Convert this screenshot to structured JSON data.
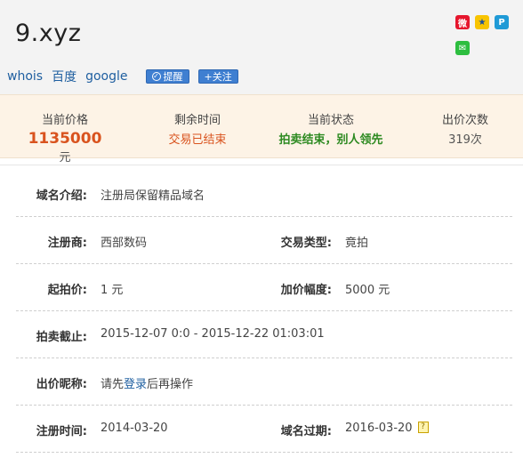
{
  "header": {
    "domain": "9.xyz",
    "links": {
      "whois": "whois",
      "baidu": "百度",
      "google": "google"
    },
    "remind_label": "提醒",
    "follow_label": "+关注"
  },
  "stats": {
    "price_label": "当前价格",
    "price_value": "1135000",
    "price_unit": "元",
    "time_label": "剩余时间",
    "time_value": "交易已结束",
    "status_label": "当前状态",
    "status_value": "拍卖结束，别人领先",
    "count_label": "出价次数",
    "count_value": "319次"
  },
  "details": {
    "intro_label": "域名介绍:",
    "intro_value": "注册局保留精品域名",
    "registrar_label": "注册商:",
    "registrar_value": "西部数码",
    "trade_type_label": "交易类型:",
    "trade_type_value": "竟拍",
    "start_price_label": "起拍价:",
    "start_price_value": "1 元",
    "increment_label": "加价幅度:",
    "increment_value": "5000 元",
    "deadline_label": "拍卖截止:",
    "deadline_value": "2015-12-07 0:0 - 2015-12-22 01:03:01",
    "nickname_label": "出价昵称:",
    "nickname_prefix": "请先",
    "nickname_link": "登录",
    "nickname_suffix": "后再操作",
    "reg_time_label": "注册时间:",
    "reg_time_value": "2014-03-20",
    "expire_label": "域名过期:",
    "expire_value": "2016-03-20"
  },
  "colors": {
    "accent": "#d9531e",
    "status_green": "#2d8a21",
    "link": "#1f5fa0",
    "stats_bg": "#fdf3e6"
  },
  "icons": [
    "weibo-icon",
    "qzone-icon",
    "tencent-weibo-icon",
    "wechat-icon",
    "remind-icon",
    "help-icon"
  ]
}
